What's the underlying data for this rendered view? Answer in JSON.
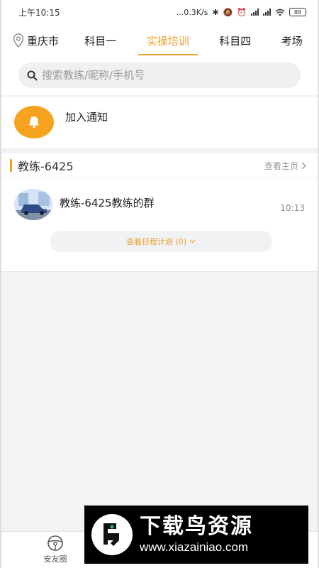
{
  "status_bar": {
    "time": "上午10:15",
    "network_speed": "...0.3K/s",
    "battery": "88"
  },
  "header": {
    "city": "重庆市",
    "tabs": [
      {
        "label": "科目一",
        "active": false
      },
      {
        "label": "实操培训",
        "active": true
      },
      {
        "label": "科目四",
        "active": false
      },
      {
        "label": "考场",
        "active": false
      }
    ]
  },
  "search": {
    "placeholder": "搜索教练/昵称/手机号",
    "value": ""
  },
  "notice": {
    "label": "加入通知",
    "icon": "bell-icon"
  },
  "coach": {
    "name": "教练-6425",
    "homepage_link": "查看主页",
    "group": {
      "name": "教练-6425教练的群",
      "time": "10:13"
    },
    "schedule_button": "查看日程计划 (0)"
  },
  "bottom_nav": {
    "items": [
      {
        "label": "安友圈",
        "icon": "steering-wheel-icon"
      }
    ]
  },
  "watermark": {
    "title": "下载鸟资源",
    "url": "www.xiazainiao.com"
  },
  "colors": {
    "accent": "#f0a030",
    "bell_bg": "#f5a31f",
    "page_bg": "#f2f3f5",
    "search_bg": "#eff0f2"
  }
}
